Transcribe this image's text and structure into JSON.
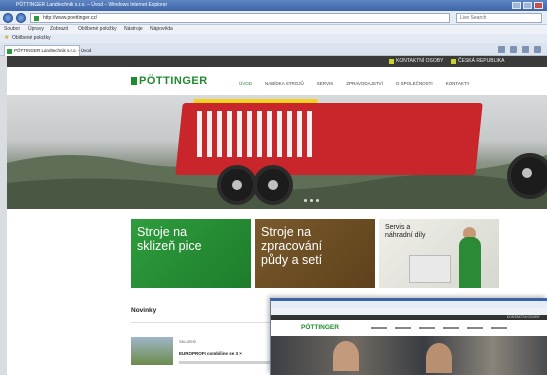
{
  "browser": {
    "window_title": "PÖTTINGER Landtechnik s.r.o. – Úvod – Windows Internet Explorer",
    "address": "http://www.poettinger.cz/",
    "search_placeholder": "Live Search",
    "menu": [
      "Soubor",
      "Úpravy",
      "Zobrazit",
      "Oblíbené položky",
      "Nástroje",
      "Nápověda"
    ],
    "favorites_label": "Oblíbené položky",
    "tab_label": "PÖTTINGER Landtechnik s.r.o. - Úvod"
  },
  "site": {
    "top_links": [
      "KONTAKTNÍ OSOBY",
      "ČESKÁ REPUBLIKA"
    ],
    "logo": "PÖTTINGER",
    "nav": [
      "ÚVOD",
      "NABÍDKA STROJŮ",
      "SERVIS",
      "ZPRAVODAJSTVÍ",
      "O SPOLEČNOSTI",
      "KONTAKTY"
    ],
    "tiles": [
      {
        "text": "Stroje na\nsklizeň pice"
      },
      {
        "text": "Stroje na\nzpracování\npůdy a setí"
      },
      {
        "text": "Servis a\nnáhradní díly"
      }
    ],
    "news": {
      "title": "Novinky",
      "category": "SKLIZEŇ",
      "headline": "EUROPROFI combiline se 3 ×"
    }
  },
  "overlay": {
    "logo": "PÖTTINGER",
    "top_link": "KONTAKTNÍ OSOBY"
  },
  "colors": {
    "brand_green": "#1f8a2e",
    "wagon_red": "#c8262b",
    "soil_brown": "#6b4d22"
  }
}
